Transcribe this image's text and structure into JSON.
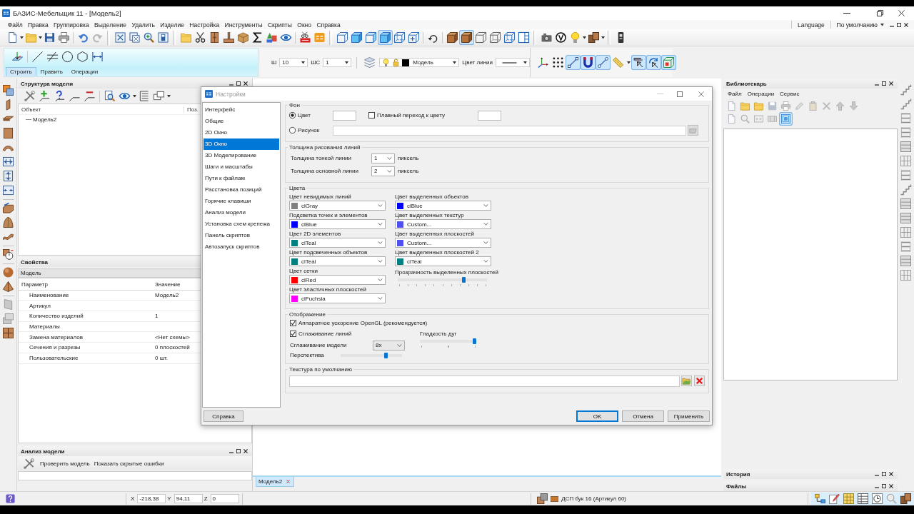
{
  "window": {
    "title": "БАЗИС-Мебельщик 11 - [Модель2]"
  },
  "menu": [
    "Файл",
    "Правка",
    "Группировка",
    "Выделение",
    "Удалить",
    "Изделие",
    "Настройка",
    "Инструменты",
    "Скрипты",
    "Окно",
    "Справка"
  ],
  "menu_right": {
    "language": "Language",
    "profile": "По умолчанию"
  },
  "main_toolbar": {
    "view_buttons": [
      {
        "pressed": false
      },
      {
        "pressed": false
      },
      {
        "pressed": false
      },
      {
        "pressed": true
      },
      {
        "pressed": false
      },
      {
        "pressed": false
      }
    ],
    "render_buttons": [
      {
        "pressed": false
      },
      {
        "pressed": true
      },
      {
        "pressed": false
      },
      {
        "pressed": false
      },
      {
        "pressed": false
      },
      {
        "pressed": false
      }
    ]
  },
  "build_panel": {
    "tabs": [
      {
        "label": "Строить",
        "selected": true
      },
      {
        "label": "Править",
        "selected": false
      },
      {
        "label": "Операции",
        "selected": false
      }
    ]
  },
  "drawing_settings": {
    "step_label": "Ш",
    "step": "10",
    "grid_step_label": "ШС",
    "grid_step": "1",
    "layer": "Модель",
    "line_color_label": "Цвет линии"
  },
  "snap_toolbar": [
    {
      "pressed": false
    },
    {
      "pressed": false
    },
    {
      "pressed": true
    },
    {
      "pressed": true
    },
    {
      "pressed": true
    },
    {
      "pressed": false
    },
    {
      "pressed": true
    },
    {
      "pressed": true
    },
    {
      "pressed": true
    }
  ],
  "model_structure": {
    "title": "Структура модели",
    "columns": [
      "Объект",
      "Поз."
    ],
    "tree": [
      {
        "label": "Модель2"
      }
    ]
  },
  "properties": {
    "title": "Свойства",
    "object": "Модель",
    "columns": [
      "Параметр",
      "Значение"
    ],
    "rows": [
      {
        "name": "Наименование",
        "value": "Модель2"
      },
      {
        "name": "Артикул"
      },
      {
        "name": "Количество изделий",
        "value": "1"
      },
      {
        "name": "Материалы"
      },
      {
        "name": "Замена материалов",
        "value": "<Нет схемы>"
      },
      {
        "name": "Сечения и разрезы",
        "value": "0 плоскостей"
      },
      {
        "name": "Пользовательские",
        "value": "0 шт."
      }
    ]
  },
  "model_analysis": {
    "title": "Анализ модели",
    "actions": [
      "Проверить модель",
      "Показать скрытые ошибки"
    ]
  },
  "document_tabs": [
    {
      "label": "Модель2",
      "selected": true
    }
  ],
  "librarian": {
    "title": "Библиотекарь",
    "menu": [
      "Файл",
      "Операции",
      "Сервис"
    ],
    "toolbar": [
      {
        "pressed": false
      },
      {
        "pressed": false
      },
      {
        "pressed": false
      },
      {
        "pressed": false
      },
      {
        "pressed": false
      },
      {
        "pressed": false
      },
      {
        "pressed": false
      },
      {
        "pressed": false
      },
      {
        "pressed": false
      },
      {
        "pressed": false
      },
      {
        "pressed": false
      },
      {
        "pressed": false
      },
      {
        "pressed": false
      },
      {
        "pressed": false
      },
      {
        "pressed": true
      }
    ]
  },
  "history": {
    "title": "История"
  },
  "files": {
    "title": "Файлы"
  },
  "status_bar": {
    "coordinates": [
      {
        "axis": "X",
        "value": "-218,38"
      },
      {
        "axis": "Y",
        "value": "94,11"
      },
      {
        "axis": "Z",
        "value": "0"
      }
    ],
    "material": "ДСП бук 16 (Артикул 60)"
  },
  "dialog": {
    "title": "Настройки",
    "categories": [
      {
        "label": "Интерфейс",
        "selected": false
      },
      {
        "label": "Общие",
        "selected": false
      },
      {
        "label": "2D Окно",
        "selected": false
      },
      {
        "label": "3D Окно",
        "selected": true
      },
      {
        "label": "3D Моделирование",
        "selected": false
      },
      {
        "label": "Шаги и масштабы",
        "selected": false
      },
      {
        "label": "Пути к файлам",
        "selected": false
      },
      {
        "label": "Расстановка позиций",
        "selected": false
      },
      {
        "label": "Горячие клавиши",
        "selected": false
      },
      {
        "label": "Анализ модели",
        "selected": false
      },
      {
        "label": "Установка схем крепежа",
        "selected": false
      },
      {
        "label": "Панель скриптов",
        "selected": false
      },
      {
        "label": "Автозапуск скриптов",
        "selected": false
      }
    ],
    "background": {
      "title": "Фон",
      "options": [
        {
          "label": "Цвет",
          "selected": true
        },
        {
          "label": "Рисунок",
          "selected": false
        }
      ],
      "gradient": {
        "label": "Плавный переход к цвету",
        "checked": false
      }
    },
    "line_thickness": {
      "title": "Толщина рисования линий",
      "rows": [
        {
          "label": "Толщина тонкой линии",
          "value": "1",
          "unit": "пиксель"
        },
        {
          "label": "Толщина основной линии",
          "value": "2",
          "unit": "пиксель"
        }
      ]
    },
    "colors": {
      "title": "Цвета",
      "left": [
        {
          "label": "Цвет невидимых линий",
          "value": "clGray",
          "color": "#808080"
        },
        {
          "label": "Подсветка точек и элементов",
          "value": "clBlue",
          "color": "#0000ff"
        },
        {
          "label": "Цвет 2D элементов",
          "value": "clTeal",
          "color": "#008080"
        },
        {
          "label": "Цвет подсвеченных объектов",
          "value": "clTeal",
          "color": "#008080"
        },
        {
          "label": "Цвет сетки",
          "value": "clRed",
          "color": "#ff0000"
        },
        {
          "label": "Цвет эластичных плоскостей",
          "value": "clFuchsia",
          "color": "#ff00ff"
        }
      ],
      "right": [
        {
          "label": "Цвет выделенных объектов",
          "value": "clBlue",
          "color": "#0000ff"
        },
        {
          "label": "Цвет выделенных текстур",
          "value": "Custom...",
          "color": "#5050f0"
        },
        {
          "label": "Цвет выделенных плоскостей",
          "value": "Custom...",
          "color": "#5050f0"
        },
        {
          "label": "Цвет выделенных плоскостей 2",
          "value": "clTeal",
          "color": "#008080"
        }
      ],
      "transparency": {
        "label": "Прозрачность выделенных плоскостей",
        "level": 0.75
      }
    },
    "display": {
      "title": "Отображение",
      "options": [
        {
          "label": "Аппаратное ускорение OpenGL (рекомендуется)",
          "checked": true
        },
        {
          "label": "Сглаживание линий",
          "checked": true
        }
      ],
      "arc_smoothness": {
        "label": "Гладкость дуг",
        "level": 1
      },
      "model_smoothing": {
        "label": "Сглаживание модели",
        "value": "8x"
      },
      "perspective": {
        "label": "Перспектива",
        "level": 0.75
      }
    },
    "default_texture": {
      "title": "Текстура по умолчанию"
    },
    "buttons": [
      {
        "label": "Справка",
        "default": false
      },
      {
        "label": "OK",
        "default": true
      },
      {
        "label": "Отмена",
        "default": false
      },
      {
        "label": "Применить",
        "default": false
      }
    ]
  }
}
